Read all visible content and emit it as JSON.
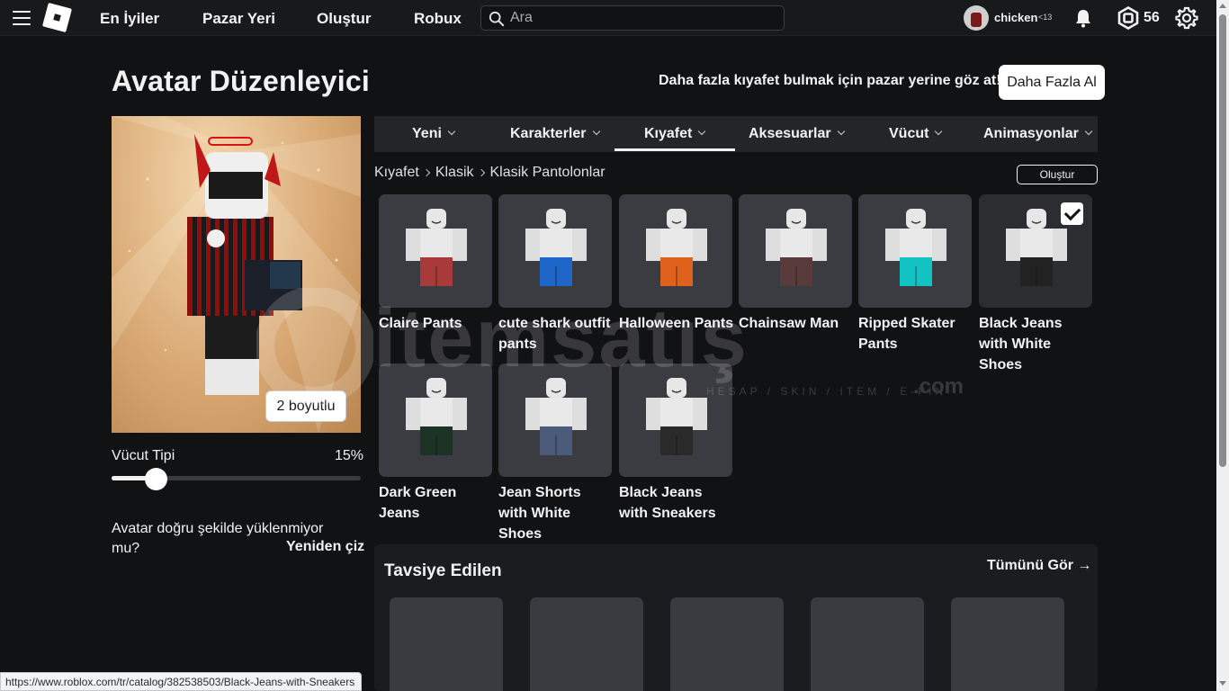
{
  "topbar": {
    "nav": [
      "En İyiler",
      "Pazar Yeri",
      "Oluştur",
      "Robux"
    ],
    "search_placeholder": "Ara",
    "username": "chicken",
    "age_tag": "<13",
    "robux": "56"
  },
  "header": {
    "title": "Avatar Düzenleyici",
    "promo": "Daha fazla kıyafet bulmak için pazar yerine göz at!",
    "get_more_label": "Daha Fazla Al"
  },
  "preview": {
    "toggle_2d_label": "2 boyutlu"
  },
  "body_type": {
    "label": "Vücut Tipi",
    "value_text": "15%",
    "value": 0.15
  },
  "load_issue": {
    "message": "Avatar doğru şekilde yüklenmiyor mu?",
    "redraw_label": "Yeniden çiz"
  },
  "tabs": [
    {
      "label": "Yeni",
      "active": false
    },
    {
      "label": "Karakterler",
      "active": false
    },
    {
      "label": "Kıyafet",
      "active": true
    },
    {
      "label": "Aksesuarlar",
      "active": false
    },
    {
      "label": "Vücut",
      "active": false
    },
    {
      "label": "Animasyonlar",
      "active": false
    }
  ],
  "breadcrumb": [
    "Kıyafet",
    "Klasik",
    "Klasik Pantolonlar"
  ],
  "create_label": "Oluştur",
  "items": [
    {
      "name": "Claire Pants",
      "pants_color": "#a83a3a",
      "selected": false
    },
    {
      "name": "cute shark outfit pants",
      "pants_color": "#1f66c9",
      "selected": false
    },
    {
      "name": "Halloween Pants",
      "pants_color": "#e0611c",
      "selected": false
    },
    {
      "name": "Chainsaw Man",
      "pants_color": "#5a3b3b",
      "selected": false
    },
    {
      "name": "Ripped Skater Pants",
      "pants_color": "#13c3c3",
      "selected": false
    },
    {
      "name": "Black Jeans with White Shoes",
      "pants_color": "#222222",
      "selected": true
    },
    {
      "name": "Dark Green Jeans",
      "pants_color": "#1c3326",
      "selected": false
    },
    {
      "name": "Jean Shorts with White Shoes",
      "pants_color": "#4d5b7a",
      "selected": false
    },
    {
      "name": "Black Jeans with Sneakers",
      "pants_color": "#2a2a2a",
      "selected": false
    }
  ],
  "recommended": {
    "title": "Tavsiye Edilen",
    "see_all_label": "Tümünü Gör →"
  },
  "watermark": {
    "brand": "itemsatış",
    "tagline": "HESAP / SKIN / ITEM / E-PIN",
    "suffix": ".com"
  },
  "status_url": "https://www.roblox.com/tr/catalog/382538503/Black-Jeans-with-Sneakers"
}
